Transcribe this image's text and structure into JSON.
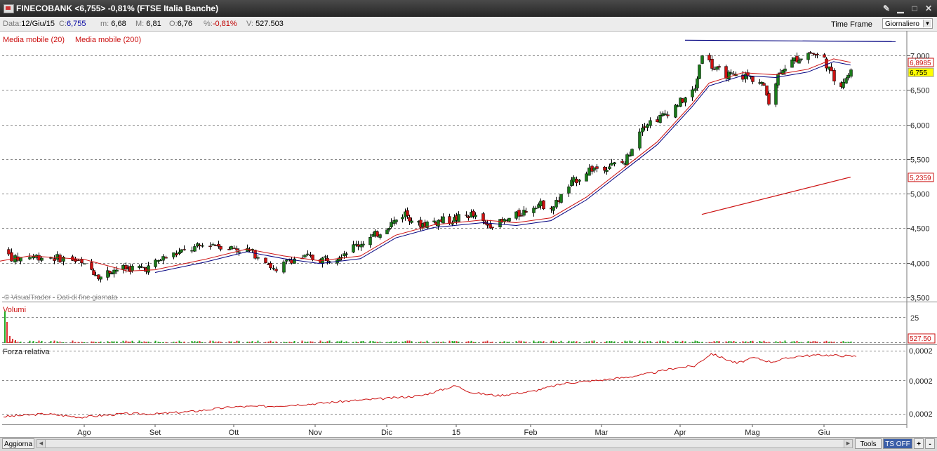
{
  "window": {
    "title": "FINECOBANK <6,755> -0,81% (FTSE Italia Banche)"
  },
  "infobar": {
    "data_label": "Data:",
    "data_value": "12/Giu/15",
    "c_label": "C:",
    "c_value": "6,755",
    "m_label": "m:",
    "m_value": "6,68",
    "max_label": "M:",
    "max_value": "6,81",
    "o_label": "O:",
    "o_value": "6,76",
    "pct_label": "%:",
    "pct_value": "-0,81%",
    "v_label": "V:",
    "v_value": "527.503",
    "timeframe_label": "Time Frame",
    "timeframe_value": "Giornaliero"
  },
  "legend": {
    "ma20": "Media mobile (20)",
    "ma200": "Media mobile (200)"
  },
  "watermark": "© VisualTrader - Dati di fine giornata",
  "volume_panel": {
    "title": "Volumi",
    "tick": "25",
    "last_value": "527.50"
  },
  "rs_panel": {
    "title": "Forza relativa",
    "ticks": [
      "0,0002",
      "0,0002",
      "0,0002"
    ]
  },
  "bottombar": {
    "update": "Aggiorna",
    "tools": "Tools",
    "ts": "TS OFF",
    "plus": "+",
    "minus": "-"
  },
  "colors": {
    "up": "#1a7a1a",
    "down": "#cc1111",
    "ma20": "#cc1111",
    "ma200": "#cc1111",
    "trend": "#000080",
    "rs": "#cc1111",
    "price_tag": "#ffff00"
  },
  "chart_data": {
    "type": "candlestick",
    "price_axis": {
      "min": 3.5,
      "max": 7.0,
      "ticks": [
        "3,500",
        "4,000",
        "4,500",
        "5,000",
        "5,500",
        "6,000",
        "6,500",
        "7,000"
      ]
    },
    "months": [
      "Ago",
      "Set",
      "Ott",
      "Nov",
      "Dic",
      "15",
      "Feb",
      "Mar",
      "Apr",
      "Mag",
      "Giu"
    ],
    "price_tags": {
      "ma20": "6,8985",
      "last": "6,755",
      "ma200": "5,2359"
    },
    "close_path": [
      [
        "2014-07-01",
        4.1
      ],
      [
        "2014-07-03",
        4.22
      ],
      [
        "2014-07-09",
        4.05
      ],
      [
        "2014-07-14",
        4.1
      ],
      [
        "2014-07-21",
        4.08
      ],
      [
        "2014-07-28",
        4.05
      ],
      [
        "2014-08-01",
        3.95
      ],
      [
        "2014-08-05",
        3.88
      ],
      [
        "2014-08-08",
        3.8
      ],
      [
        "2014-08-13",
        3.9
      ],
      [
        "2014-08-20",
        3.92
      ],
      [
        "2014-08-29",
        3.93
      ],
      [
        "2014-09-03",
        4.05
      ],
      [
        "2014-09-08",
        4.12
      ],
      [
        "2014-09-15",
        4.2
      ],
      [
        "2014-09-22",
        4.28
      ],
      [
        "2014-09-30",
        4.22
      ],
      [
        "2014-10-06",
        4.18
      ],
      [
        "2014-10-13",
        4.05
      ],
      [
        "2014-10-17",
        3.85
      ],
      [
        "2014-10-22",
        4.05
      ],
      [
        "2014-10-29",
        4.08
      ],
      [
        "2014-11-03",
        4.05
      ],
      [
        "2014-11-10",
        4.1
      ],
      [
        "2014-11-18",
        4.25
      ],
      [
        "2014-11-26",
        4.4
      ],
      [
        "2014-12-02",
        4.55
      ],
      [
        "2014-12-09",
        4.72
      ],
      [
        "2014-12-15",
        4.55
      ],
      [
        "2014-12-22",
        4.6
      ],
      [
        "2014-12-30",
        4.62
      ],
      [
        "2015-01-07",
        4.7
      ],
      [
        "2015-01-13",
        4.55
      ],
      [
        "2015-01-20",
        4.58
      ],
      [
        "2015-01-27",
        4.7
      ],
      [
        "2015-02-03",
        4.85
      ],
      [
        "2015-02-10",
        4.82
      ],
      [
        "2015-02-17",
        5.15
      ],
      [
        "2015-02-24",
        5.35
      ],
      [
        "2015-03-03",
        5.4
      ],
      [
        "2015-03-10",
        5.45
      ],
      [
        "2015-03-17",
        6.0
      ],
      [
        "2015-03-24",
        6.1
      ],
      [
        "2015-03-31",
        6.3
      ],
      [
        "2015-04-07",
        6.5
      ],
      [
        "2015-04-10",
        7.05
      ],
      [
        "2015-04-15",
        6.8
      ],
      [
        "2015-04-22",
        6.7
      ],
      [
        "2015-04-29",
        6.7
      ],
      [
        "2015-05-05",
        6.6
      ],
      [
        "2015-05-08",
        6.35
      ],
      [
        "2015-05-13",
        6.8
      ],
      [
        "2015-05-20",
        6.95
      ],
      [
        "2015-05-26",
        7.05
      ],
      [
        "2015-06-01",
        6.95
      ],
      [
        "2015-06-05",
        6.65
      ],
      [
        "2015-06-08",
        6.6
      ],
      [
        "2015-06-12",
        6.755
      ]
    ],
    "ma20_path": [
      [
        "2014-07-01",
        4.0
      ],
      [
        "2014-07-14",
        4.1
      ],
      [
        "2014-08-01",
        4.05
      ],
      [
        "2014-08-20",
        3.88
      ],
      [
        "2014-09-01",
        3.9
      ],
      [
        "2014-09-20",
        4.05
      ],
      [
        "2014-10-06",
        4.2
      ],
      [
        "2014-10-20",
        4.1
      ],
      [
        "2014-11-03",
        4.03
      ],
      [
        "2014-11-20",
        4.1
      ],
      [
        "2014-12-05",
        4.4
      ],
      [
        "2014-12-22",
        4.55
      ],
      [
        "2015-01-12",
        4.62
      ],
      [
        "2015-01-26",
        4.58
      ],
      [
        "2015-02-09",
        4.65
      ],
      [
        "2015-02-23",
        4.95
      ],
      [
        "2015-03-09",
        5.35
      ],
      [
        "2015-03-23",
        5.75
      ],
      [
        "2015-04-06",
        6.3
      ],
      [
        "2015-04-13",
        6.6
      ],
      [
        "2015-04-27",
        6.75
      ],
      [
        "2015-05-11",
        6.72
      ],
      [
        "2015-05-25",
        6.8
      ],
      [
        "2015-06-05",
        6.95
      ],
      [
        "2015-06-12",
        6.9
      ]
    ],
    "ma200_segment": [
      [
        "2015-04-10",
        4.7
      ],
      [
        "2015-06-12",
        5.24
      ]
    ],
    "trendline": {
      "from": [
        "2015-04-10",
        7.22
      ],
      "to": [
        "2015-07-09",
        7.2
      ]
    },
    "rs_path": [
      [
        0,
        0.2
      ],
      [
        0.05,
        0.3
      ],
      [
        0.09,
        0.18
      ],
      [
        0.14,
        0.3
      ],
      [
        0.18,
        0.3
      ],
      [
        0.22,
        0.38
      ],
      [
        0.27,
        0.55
      ],
      [
        0.31,
        0.57
      ],
      [
        0.36,
        0.65
      ],
      [
        0.4,
        0.75
      ],
      [
        0.45,
        0.85
      ],
      [
        0.49,
        0.95
      ],
      [
        0.53,
        1.3
      ],
      [
        0.55,
        1.05
      ],
      [
        0.58,
        0.95
      ],
      [
        0.62,
        1.1
      ],
      [
        0.66,
        1.4
      ],
      [
        0.7,
        1.5
      ],
      [
        0.73,
        1.6
      ],
      [
        0.76,
        1.75
      ],
      [
        0.79,
        1.95
      ],
      [
        0.81,
        2.0
      ],
      [
        0.83,
        2.45
      ],
      [
        0.86,
        2.1
      ],
      [
        0.88,
        2.3
      ],
      [
        0.9,
        2.15
      ],
      [
        0.93,
        2.35
      ],
      [
        0.96,
        2.4
      ],
      [
        1.0,
        2.35
      ]
    ]
  }
}
